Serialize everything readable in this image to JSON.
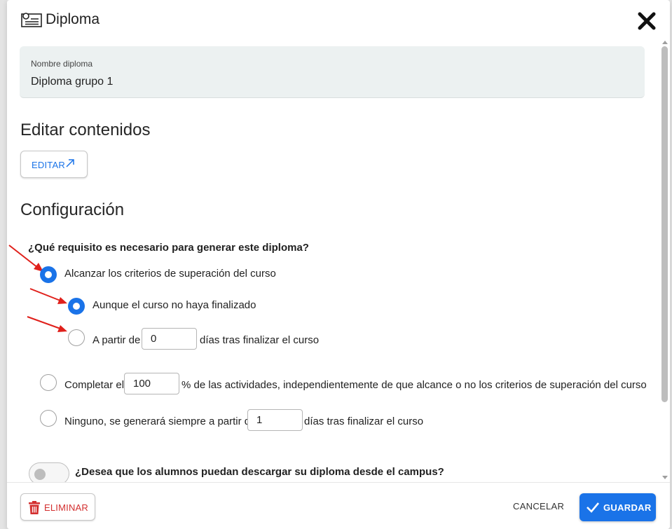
{
  "dialog": {
    "title": "Diploma",
    "header_icon": "certificate-icon",
    "close_icon": "close-icon"
  },
  "name_field": {
    "label": "Nombre diploma",
    "value": "Diploma grupo 1"
  },
  "edit_section": {
    "heading": "Editar contenidos",
    "button_label": "EDITAR",
    "button_icon": "external-arrow-icon"
  },
  "config_section": {
    "heading": "Configuración",
    "question": "¿Qué requisito es necesario para generar este diploma?",
    "options": {
      "criteria": {
        "label": "Alcanzar los criterios de superación del curso",
        "selected": true
      },
      "not_finished": {
        "label": "Aunque el curso no haya finalizado",
        "selected": true
      },
      "after_days": {
        "prefix": "A partir de",
        "value": "0",
        "suffix": "días tras finalizar el curso",
        "selected": false
      },
      "complete_pct": {
        "prefix": "Completar el",
        "value": "100",
        "suffix": "% de las actividades, independientemente de que alcance o no los criterios de superación del curso",
        "selected": false
      },
      "none": {
        "prefix": "Ninguno, se generará siempre a partir de",
        "value": "1",
        "suffix": "días tras finalizar el curso",
        "selected": false
      }
    }
  },
  "download_toggle": {
    "label": "¿Desea que los alumnos puedan descargar su diploma desde el campus?",
    "enabled": false
  },
  "footer": {
    "delete_label": "ELIMINAR",
    "delete_icon": "trash-icon",
    "cancel_label": "CANCELAR",
    "save_label": "GUARDAR",
    "save_icon": "check-icon"
  },
  "colors": {
    "accent": "#1a73e8",
    "danger": "#d32f2f",
    "annotation_arrow": "#e0201b",
    "field_bg": "#ecf1f1"
  }
}
